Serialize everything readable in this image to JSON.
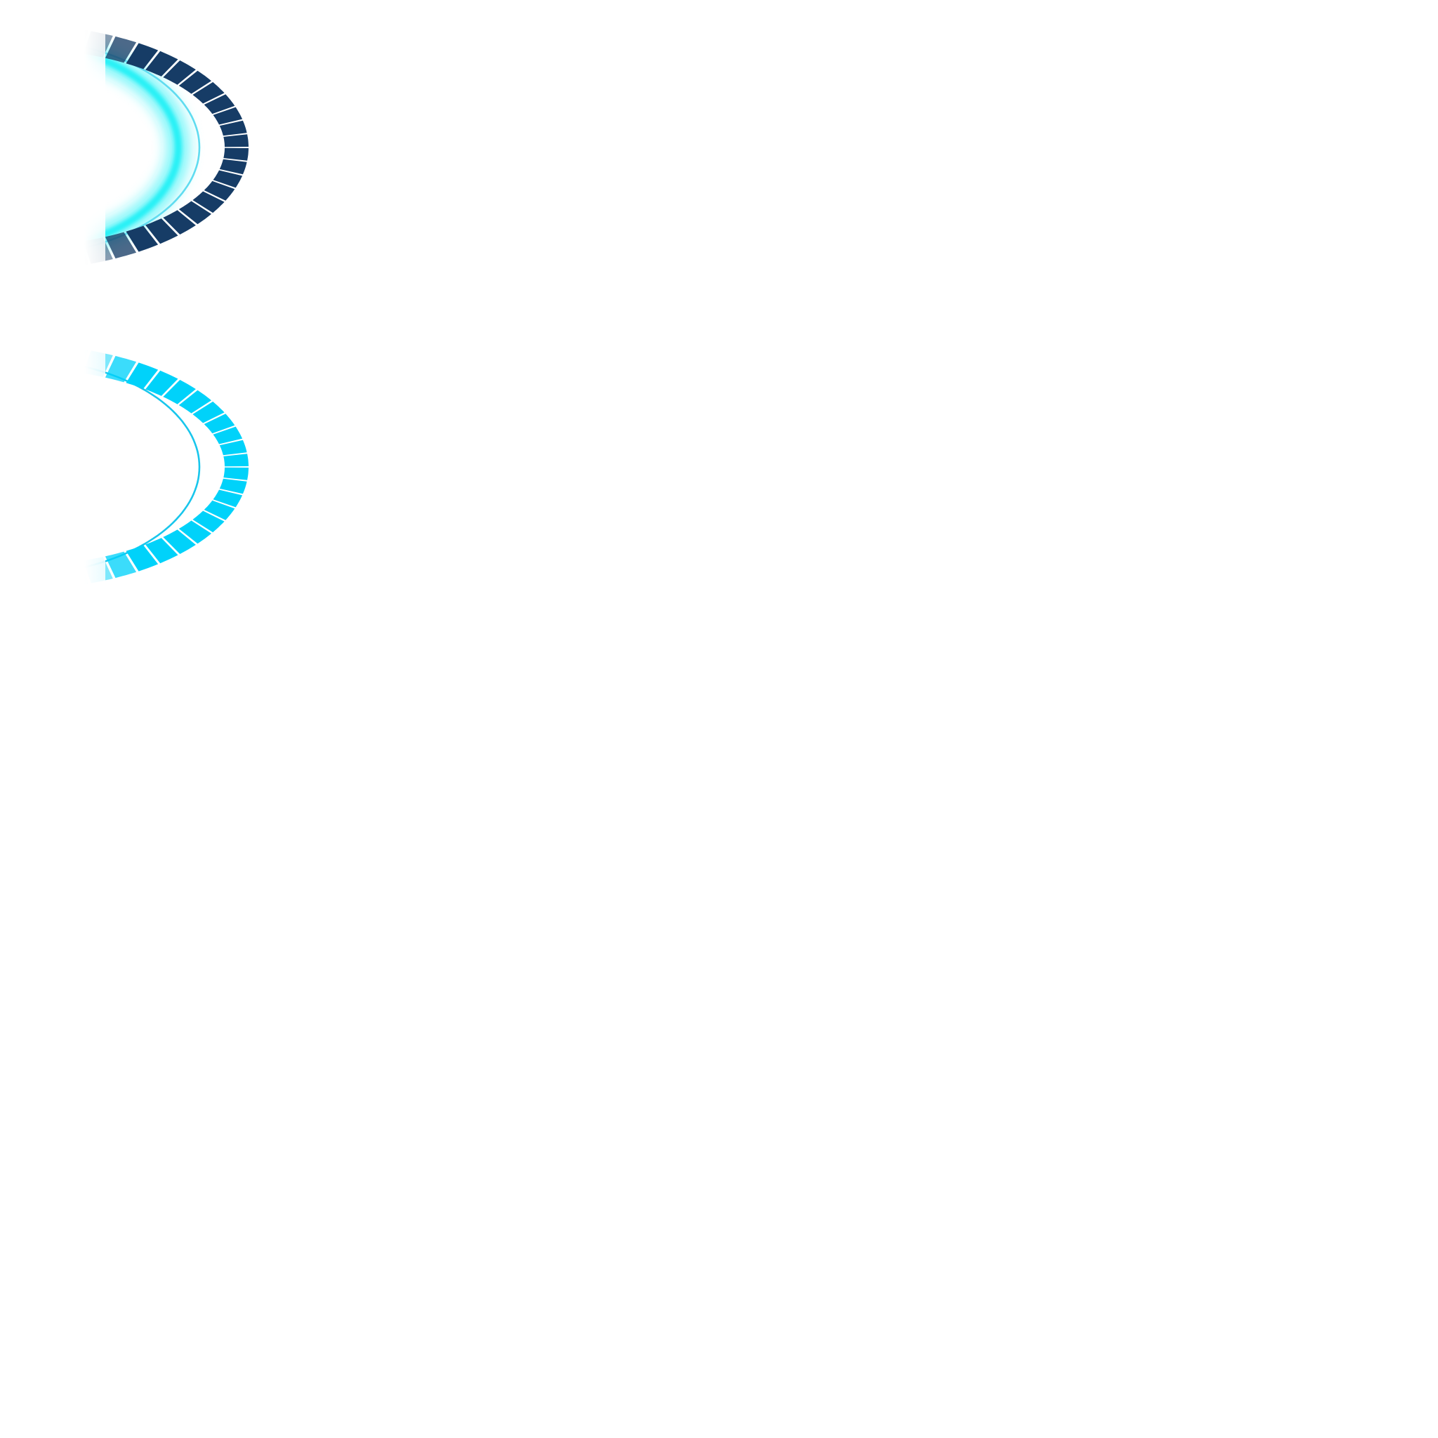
{
  "sprites": [
    {
      "name": "dark-segmented-arc",
      "segment_color": "#163c66",
      "inner_line_color": "#5fdcf0",
      "glow_color": "#1ef0f5",
      "has_glow": true
    },
    {
      "name": "cyan-segmented-arc",
      "segment_color": "#00d2fa",
      "inner_line_color": "#18c6ec",
      "glow_color": "",
      "has_glow": false
    }
  ]
}
